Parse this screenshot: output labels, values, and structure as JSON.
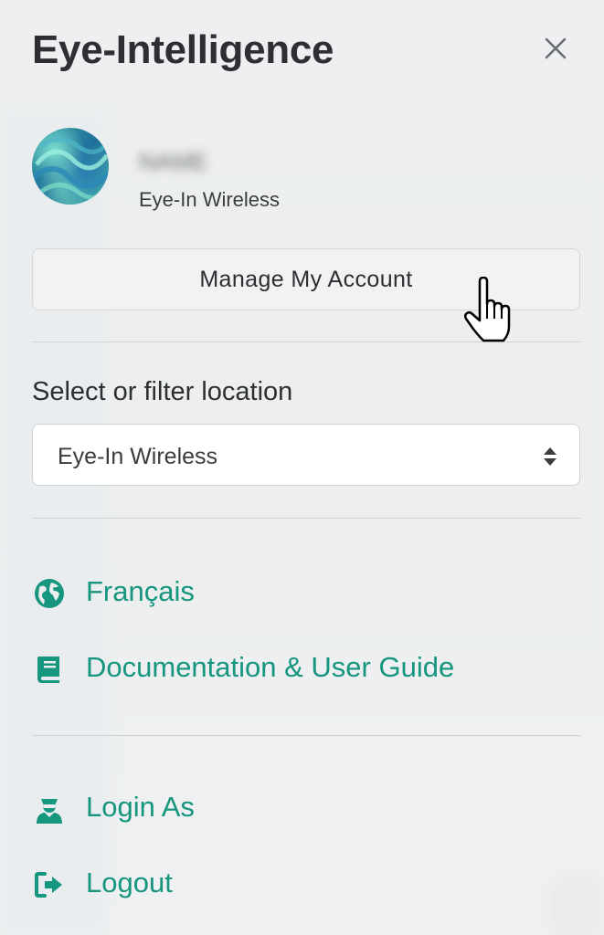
{
  "panel": {
    "title": "Eye-Intelligence",
    "close_icon": "close-icon"
  },
  "user": {
    "name": "NAME",
    "organization": "Eye-In Wireless"
  },
  "manage_account_label": "Manage My Account",
  "location": {
    "label": "Select or filter location",
    "selected": "Eye-In Wireless"
  },
  "menu": {
    "language": {
      "label": "Français",
      "icon": "globe-icon"
    },
    "docs": {
      "label": "Documentation & User Guide",
      "icon": "book-icon"
    },
    "login_as": {
      "label": "Login As",
      "icon": "user-secret-icon"
    },
    "logout": {
      "label": "Logout",
      "icon": "sign-out-icon"
    }
  },
  "colors": {
    "accent": "#16957f",
    "panel_bg": "#eceeef",
    "text": "#2d2f33"
  }
}
